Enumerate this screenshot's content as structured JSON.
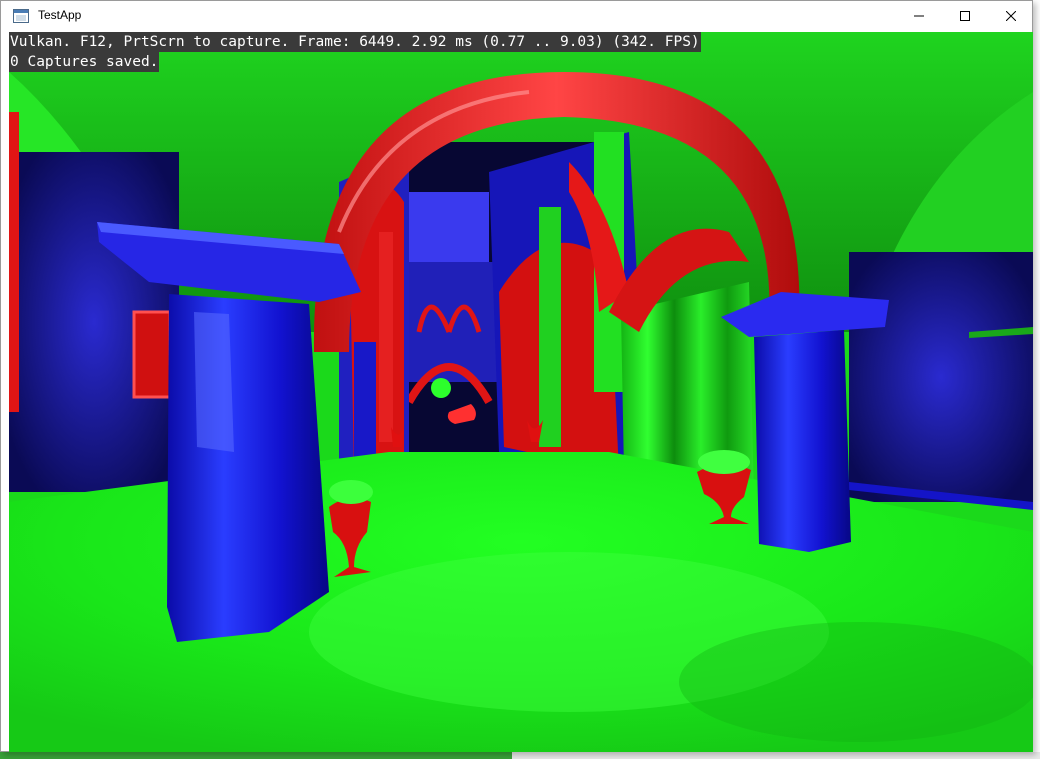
{
  "window": {
    "title": "TestApp",
    "icons": {
      "app": "app-window-icon",
      "minimize": "minimize-icon",
      "maximize": "maximize-icon",
      "close": "close-icon"
    }
  },
  "overlay": {
    "line1": "Vulkan. F12, PrtScrn to capture. Frame: 6449. 2.92 ms (0.77 .. 9.03) (342. FPS)",
    "line2": "0 Captures saved."
  },
  "colors": {
    "green": "#1ee01e",
    "blue": "#1a1ad8",
    "red": "#e01515",
    "dark": "#05052a"
  }
}
